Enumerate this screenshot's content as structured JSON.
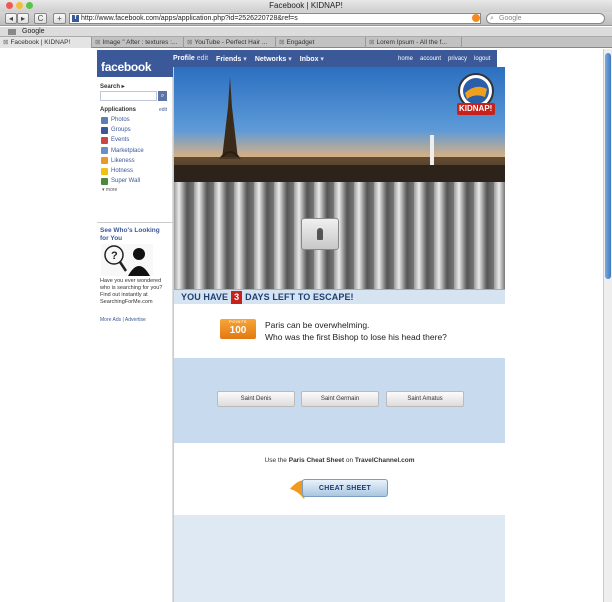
{
  "browser": {
    "window_title": "Facebook | KIDNAP!",
    "url": "http://www.facebook.com/apps/application.php?id=2526220728&ref=s",
    "search_placeholder": "Google",
    "bookmark": "Google",
    "tabs": [
      {
        "label": "Facebook | KIDNAP!",
        "active": true
      },
      {
        "label": "Image \" After : textures :...",
        "active": false
      },
      {
        "label": "YouTube - Perfect Hair ...",
        "active": false
      },
      {
        "label": "Engadget",
        "active": false
      },
      {
        "label": "Lorem Ipsum - All the f...",
        "active": false
      }
    ],
    "nav": {
      "back": "◂",
      "forward": "▸",
      "reload": "C",
      "add": "+"
    }
  },
  "facebook": {
    "logo": "facebook",
    "menu": [
      {
        "label": "Profile",
        "secondary": "edit"
      },
      {
        "label": "Friends",
        "secondary": "▾"
      },
      {
        "label": "Networks",
        "secondary": "▾"
      },
      {
        "label": "Inbox",
        "secondary": "▾"
      }
    ],
    "right_links": [
      "home",
      "account",
      "privacy",
      "logout"
    ],
    "sidebar": {
      "search_label": "Search ▸",
      "search_button": "🔍",
      "apps_label": "Applications",
      "apps_edit": "edit",
      "apps": [
        {
          "label": "Photos",
          "color": "#5a7fb5"
        },
        {
          "label": "Groups",
          "color": "#3b5998"
        },
        {
          "label": "Events",
          "color": "#c44"
        },
        {
          "label": "Marketplace",
          "color": "#6a8fc4"
        },
        {
          "label": "Likeness",
          "color": "#e59a2a"
        },
        {
          "label": "Hotness",
          "color": "#f2c014"
        },
        {
          "label": "Super Wall",
          "color": "#4a8a3a"
        }
      ],
      "more": "▾ more",
      "ad_title": "See Who's Looking for You",
      "ad_text": "Have you ever wondered who is searching for you? Find out instantly at SearchingForMe.com",
      "ad_links": "More Ads | Advertise"
    }
  },
  "game": {
    "banner": {
      "prefix": "YOU HAVE",
      "days": "3",
      "suffix": "DAYS LEFT TO ESCAPE!"
    },
    "points": {
      "label": "POINTS",
      "value": "100"
    },
    "question_line1": "Paris can be overwhelming.",
    "question_line2": "Who was the first Bishop to lose his head there?",
    "answers": [
      "Saint Denis",
      "Saint Germain",
      "Saint Amatus"
    ],
    "cheat_text_pre": "Use the",
    "cheat_text_bold1": "Paris Cheat Sheet",
    "cheat_text_mid": "on",
    "cheat_text_bold2": "TravelChannel.com",
    "cheat_button": "CHEAT SHEET",
    "logo": "KIDNAP!"
  }
}
